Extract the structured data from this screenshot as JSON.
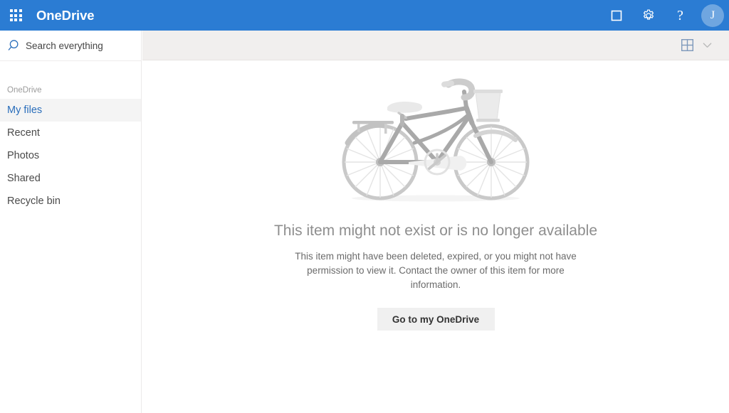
{
  "header": {
    "app_launcher_icon": "waffle-grid-icon",
    "brand": "OneDrive",
    "brand_color": "#2b7cd3",
    "actions": [
      {
        "name": "onedrive-square-icon",
        "icon": "square-outline-icon",
        "label": ""
      },
      {
        "name": "settings-gear-icon",
        "icon": "gear-icon",
        "label": ""
      },
      {
        "name": "help-icon",
        "icon": "question-mark-icon",
        "label": "?"
      }
    ],
    "avatar": {
      "initial": "J",
      "background": "#6fa6e0"
    }
  },
  "search": {
    "icon": "search-icon",
    "placeholder": "Search everything",
    "value": ""
  },
  "sidebar": {
    "group_label": "OneDrive",
    "items": [
      {
        "label": "My files",
        "selected": true
      },
      {
        "label": "Recent",
        "selected": false
      },
      {
        "label": "Photos",
        "selected": false
      },
      {
        "label": "Shared",
        "selected": false
      },
      {
        "label": "Recycle bin",
        "selected": false
      }
    ],
    "selected_color": "#2a6ebb"
  },
  "command_bar": {
    "view_icon": "tile-view-icon",
    "chevron_icon": "chevron-down-icon",
    "view_icon_color": "#7e99bb"
  },
  "main": {
    "illustration": "bicycle-illustration",
    "error_title": "This item might not exist or is no longer available",
    "error_body": "This item might have been deleted, expired, or you might not have permission to view it. Contact the owner of this item for more information.",
    "cta_label": "Go to my OneDrive"
  }
}
